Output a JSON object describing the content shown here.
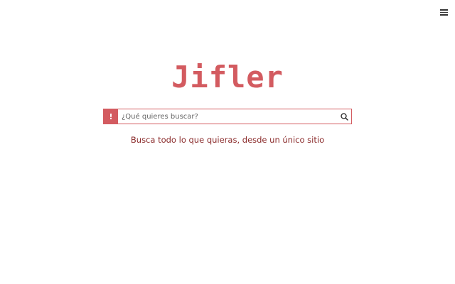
{
  "header": {
    "menu_icon": "hamburger-menu-icon"
  },
  "brand": {
    "logo_text": "Jifler",
    "color": "#d35b60"
  },
  "search": {
    "alert_symbol": "!",
    "placeholder": "¿Qué quieres buscar?",
    "value": "",
    "submit_icon": "search-icon"
  },
  "tagline": {
    "text": "Busca todo lo que quieras, desde un único sitio",
    "color": "#8b2c2c"
  }
}
